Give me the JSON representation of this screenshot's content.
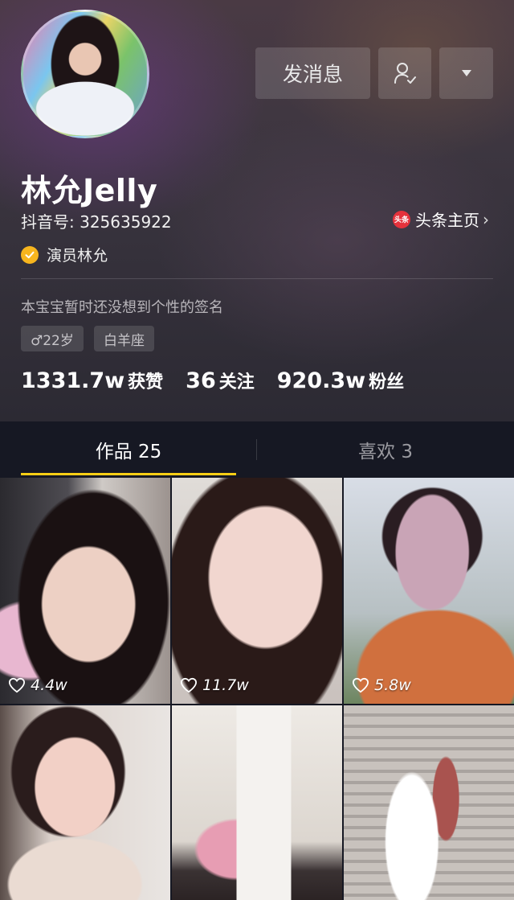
{
  "header": {
    "message_button": "发消息",
    "name": "林允Jelly",
    "douyin_id": "抖音号: 325635922",
    "toutiao_badge": "头条",
    "toutiao_link": "头条主页",
    "verified_title": "演员林允",
    "bio": "本宝宝暂时还没想到个性的签名",
    "tags": {
      "age": "♂22岁",
      "zodiac": "白羊座"
    },
    "stats": {
      "likes_num": "1331.7w",
      "likes_label": "获赞",
      "following_num": "36",
      "following_label": "关注",
      "fans_num": "920.3w",
      "fans_label": "粉丝"
    }
  },
  "tabs": {
    "works": "作品 25",
    "likes": "喜欢 3"
  },
  "videos": [
    {
      "likes": "4.4w"
    },
    {
      "likes": "11.7w"
    },
    {
      "likes": "5.8w"
    }
  ],
  "colors": {
    "accent": "#face15",
    "verified": "#f7b51e",
    "toutiao": "#e5323c",
    "background": "#161823"
  }
}
